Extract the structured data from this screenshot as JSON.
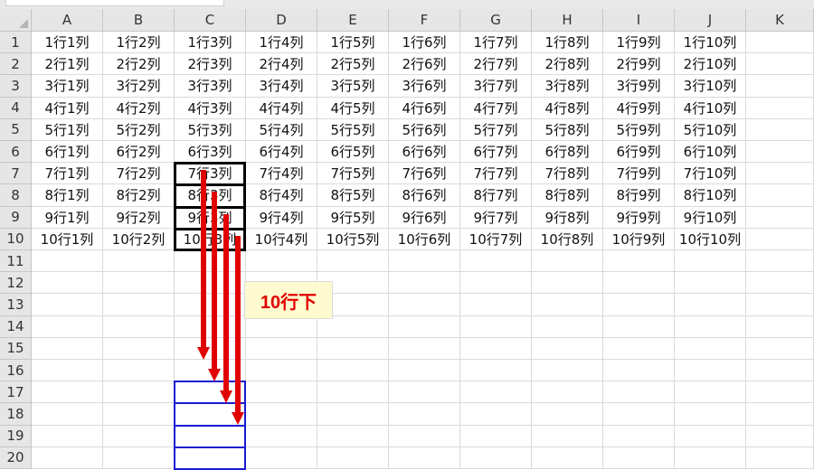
{
  "spreadsheet": {
    "column_headers": [
      "A",
      "B",
      "C",
      "D",
      "E",
      "F",
      "G",
      "H",
      "I",
      "J",
      "K"
    ],
    "row_headers": [
      "1",
      "2",
      "3",
      "4",
      "5",
      "6",
      "7",
      "8",
      "9",
      "10",
      "11",
      "12",
      "13",
      "14",
      "15",
      "16",
      "17",
      "18",
      "19",
      "20"
    ],
    "rows": [
      [
        "1行1列",
        "1行2列",
        "1行3列",
        "1行4列",
        "1行5列",
        "1行6列",
        "1行7列",
        "1行8列",
        "1行9列",
        "1行10列"
      ],
      [
        "2行1列",
        "2行2列",
        "2行3列",
        "2行4列",
        "2行5列",
        "2行6列",
        "2行7列",
        "2行8列",
        "2行9列",
        "2行10列"
      ],
      [
        "3行1列",
        "3行2列",
        "3行3列",
        "3行4列",
        "3行5列",
        "3行6列",
        "3行7列",
        "3行8列",
        "3行9列",
        "3行10列"
      ],
      [
        "4行1列",
        "4行2列",
        "4行3列",
        "4行4列",
        "4行5列",
        "4行6列",
        "4行7列",
        "4行8列",
        "4行9列",
        "4行10列"
      ],
      [
        "5行1列",
        "5行2列",
        "5行3列",
        "5行4列",
        "5行5列",
        "5行6列",
        "5行7列",
        "5行8列",
        "5行9列",
        "5行10列"
      ],
      [
        "6行1列",
        "6行2列",
        "6行3列",
        "6行4列",
        "6行5列",
        "6行6列",
        "6行7列",
        "6行8列",
        "6行9列",
        "6行10列"
      ],
      [
        "7行1列",
        "7行2列",
        "7行3列",
        "7行4列",
        "7行5列",
        "7行6列",
        "7行7列",
        "7行8列",
        "7行9列",
        "7行10列"
      ],
      [
        "8行1列",
        "8行2列",
        "8行3列",
        "8行4列",
        "8行5列",
        "8行6列",
        "8行7列",
        "8行8列",
        "8行9列",
        "8行10列"
      ],
      [
        "9行1列",
        "9行2列",
        "9行3列",
        "9行4列",
        "9行5列",
        "9行6列",
        "9行7列",
        "9行8列",
        "9行9列",
        "9行10列"
      ],
      [
        "10行1列",
        "10行2列",
        "10行3列",
        "10行4列",
        "10行5列",
        "10行6列",
        "10行7列",
        "10行8列",
        "10行9列",
        "10行10列"
      ]
    ]
  },
  "annotation": {
    "label": "10行下",
    "label_color": "#e00000",
    "label_background": "#fffbd0",
    "arrow_color": "#e00000",
    "source_border_color": "#000000",
    "target_border_color": "#1a1ad0"
  }
}
